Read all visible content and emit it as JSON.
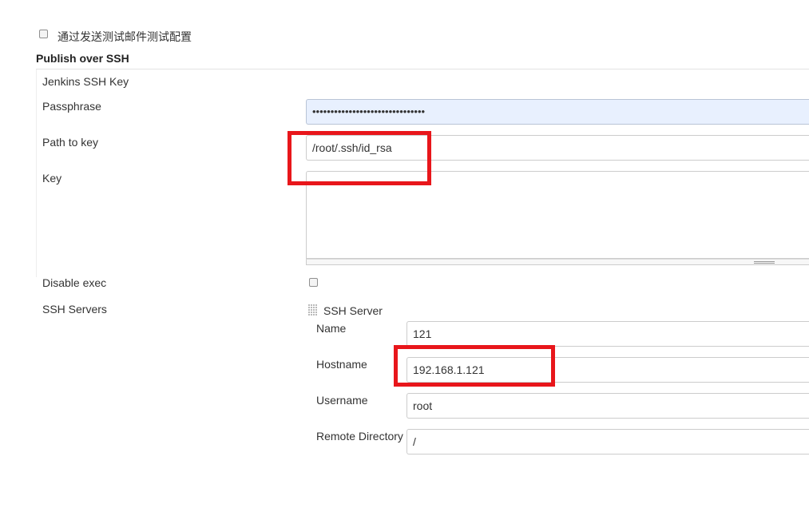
{
  "test_email": {
    "checkbox_checked": false,
    "label": "通过发送测试邮件测试配置"
  },
  "publish_over_ssh": {
    "title": "Publish over SSH",
    "jenkins_ssh_key_label": "Jenkins SSH Key",
    "passphrase": {
      "label": "Passphrase",
      "masked_value": "•••••••••••••••••••••••••••••••"
    },
    "path_to_key": {
      "label": "Path to key",
      "value": "/root/.ssh/id_rsa"
    },
    "key": {
      "label": "Key",
      "value": ""
    },
    "disable_exec": {
      "label": "Disable exec",
      "checked": false
    },
    "ssh_servers": {
      "label": "SSH Servers",
      "server_header": "SSH Server",
      "name": {
        "label": "Name",
        "value": "121"
      },
      "hostname": {
        "label": "Hostname",
        "value": "192.168.1.121"
      },
      "username": {
        "label": "Username",
        "value": "root"
      },
      "remote_directory": {
        "label": "Remote Directory",
        "value": "/"
      }
    }
  },
  "colors": {
    "highlight": "#e8161b",
    "autofill_background": "#e8f0fe",
    "field_border": "#cccccc"
  }
}
